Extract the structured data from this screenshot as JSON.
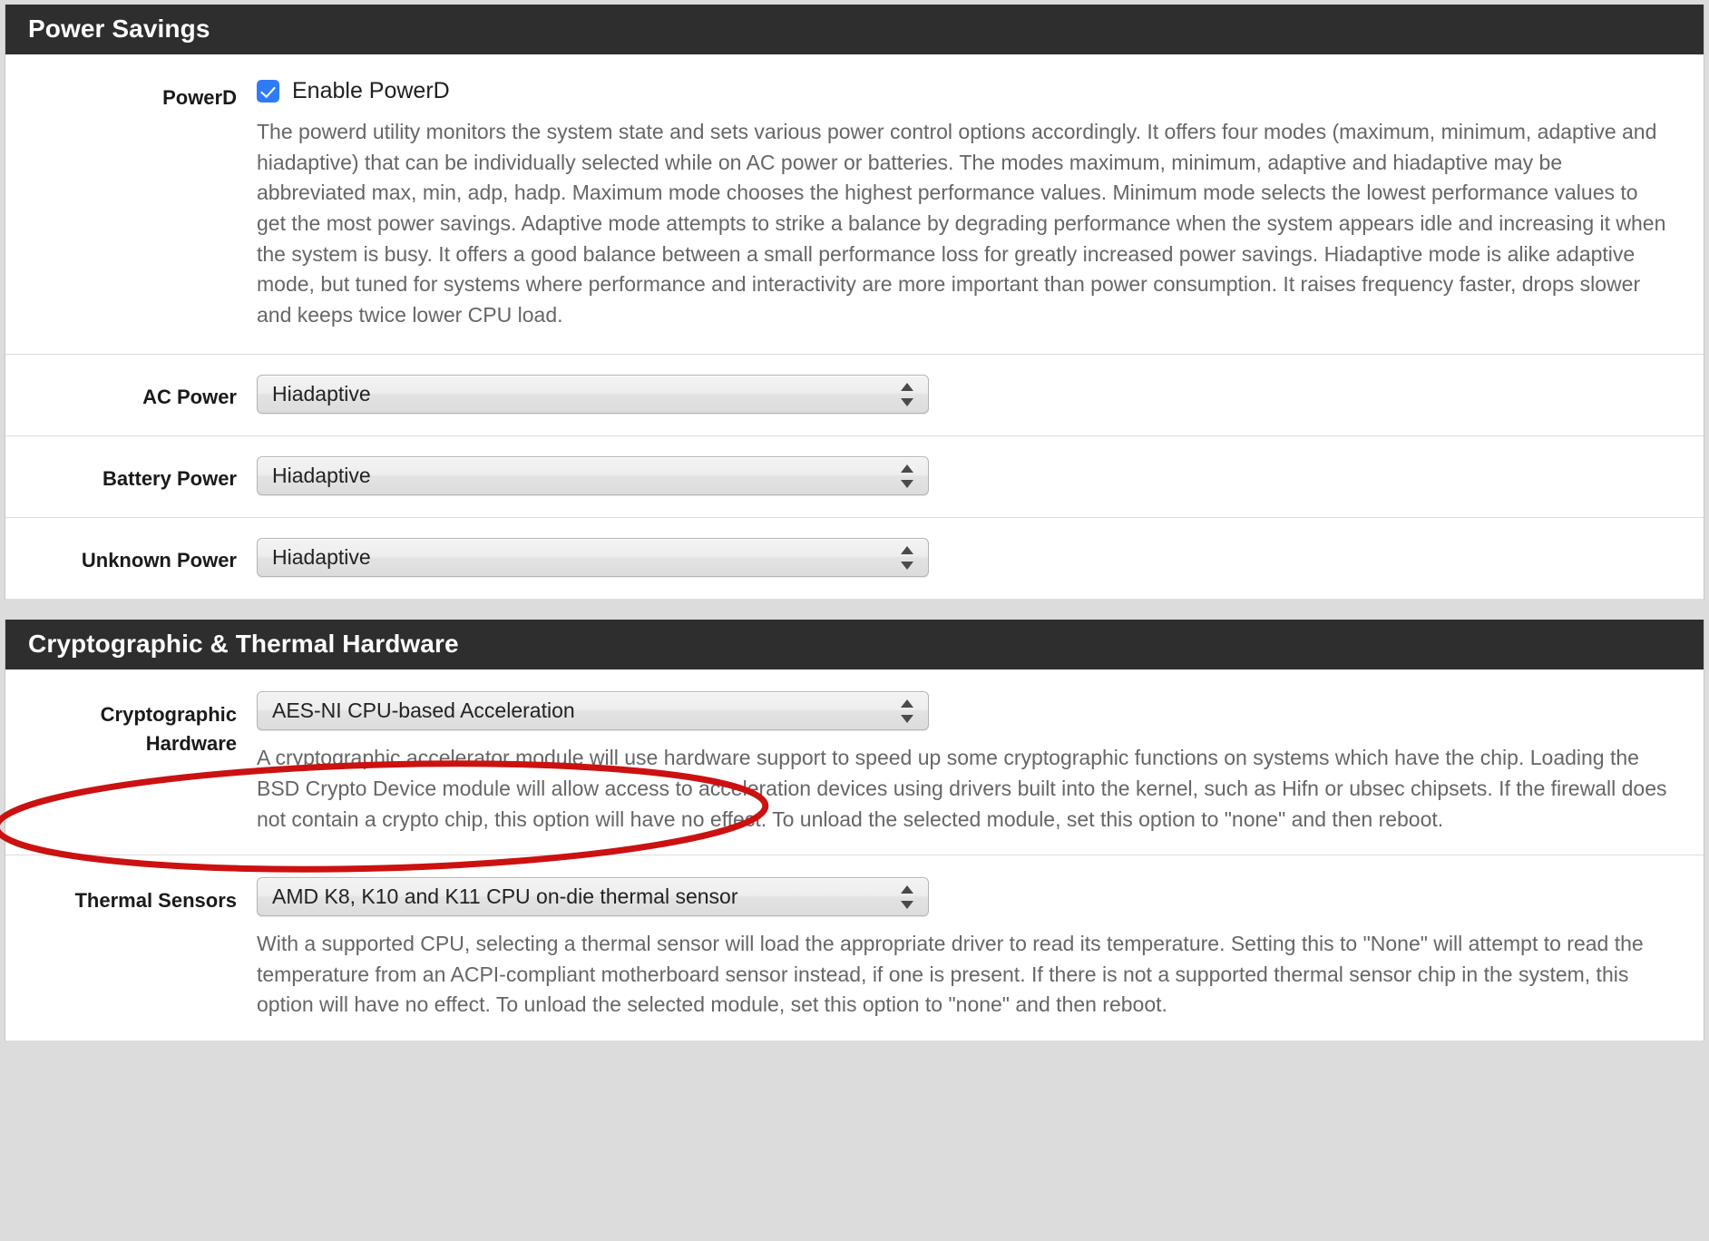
{
  "sections": [
    {
      "id": "power-savings",
      "title": "Power Savings",
      "rows": [
        {
          "id": "powerd",
          "label": "PowerD",
          "control": "checkbox",
          "checkbox_label": "Enable PowerD",
          "checked": true,
          "description": "The powerd utility monitors the system state and sets various power control options accordingly. It offers four modes (maximum, minimum, adaptive and hiadaptive) that can be individually selected while on AC power or batteries. The modes maximum, minimum, adaptive and hiadaptive may be abbreviated max, min, adp, hadp. Maximum mode chooses the highest performance values. Minimum mode selects the lowest performance values to get the most power savings. Adaptive mode attempts to strike a balance by degrading performance when the system appears idle and increasing it when the system is busy. It offers a good balance between a small performance loss for greatly increased power savings. Hiadaptive mode is alike adaptive mode, but tuned for systems where performance and interactivity are more important than power consumption. It raises frequency faster, drops slower and keeps twice lower CPU load."
        },
        {
          "id": "ac-power",
          "label": "AC Power",
          "control": "select",
          "value": "Hiadaptive",
          "description": ""
        },
        {
          "id": "battery-power",
          "label": "Battery Power",
          "control": "select",
          "value": "Hiadaptive",
          "description": ""
        },
        {
          "id": "unknown-power",
          "label": "Unknown Power",
          "control": "select",
          "value": "Hiadaptive",
          "description": ""
        }
      ]
    },
    {
      "id": "crypto-thermal",
      "title": "Cryptographic & Thermal Hardware",
      "rows": [
        {
          "id": "cryptographic-hardware",
          "label": "Cryptographic Hardware",
          "control": "select",
          "value": "AES-NI CPU-based Acceleration",
          "description": "A cryptographic accelerator module will use hardware support to speed up some cryptographic functions on systems which have the chip. Loading the BSD Crypto Device module will allow access to acceleration devices using drivers built into the kernel, such as Hifn or ubsec chipsets. If the firewall does not contain a crypto chip, this option will have no effect. To unload the selected module, set this option to \"none\" and then reboot."
        },
        {
          "id": "thermal-sensors",
          "label": "Thermal Sensors",
          "control": "select",
          "value": "AMD K8, K10 and K11 CPU on-die thermal sensor",
          "description": "With a supported CPU, selecting a thermal sensor will load the appropriate driver to read its temperature. Setting this to \"None\" will attempt to read the temperature from an ACPI-compliant motherboard sensor instead, if one is present. If there is not a supported thermal sensor chip in the system, this option will have no effect. To unload the selected module, set this option to \"none\" and then reboot."
        }
      ]
    }
  ],
  "annotation": {
    "shape": "ellipse",
    "color": "#cc1111",
    "targets": "cryptographic-hardware-row"
  },
  "colors": {
    "section_header_bg": "#2e2e2e",
    "section_header_text": "#ffffff",
    "checkbox_accent": "#2f7bf6",
    "description_text": "#666666",
    "label_text": "#1a1a1a",
    "page_bg": "#dcdcdc",
    "panel_bg": "#ffffff",
    "annotation_red": "#cc1111"
  },
  "labels": {
    "label_cryptographic_line1": "Cryptographic",
    "label_cryptographic_line2": "Hardware"
  }
}
